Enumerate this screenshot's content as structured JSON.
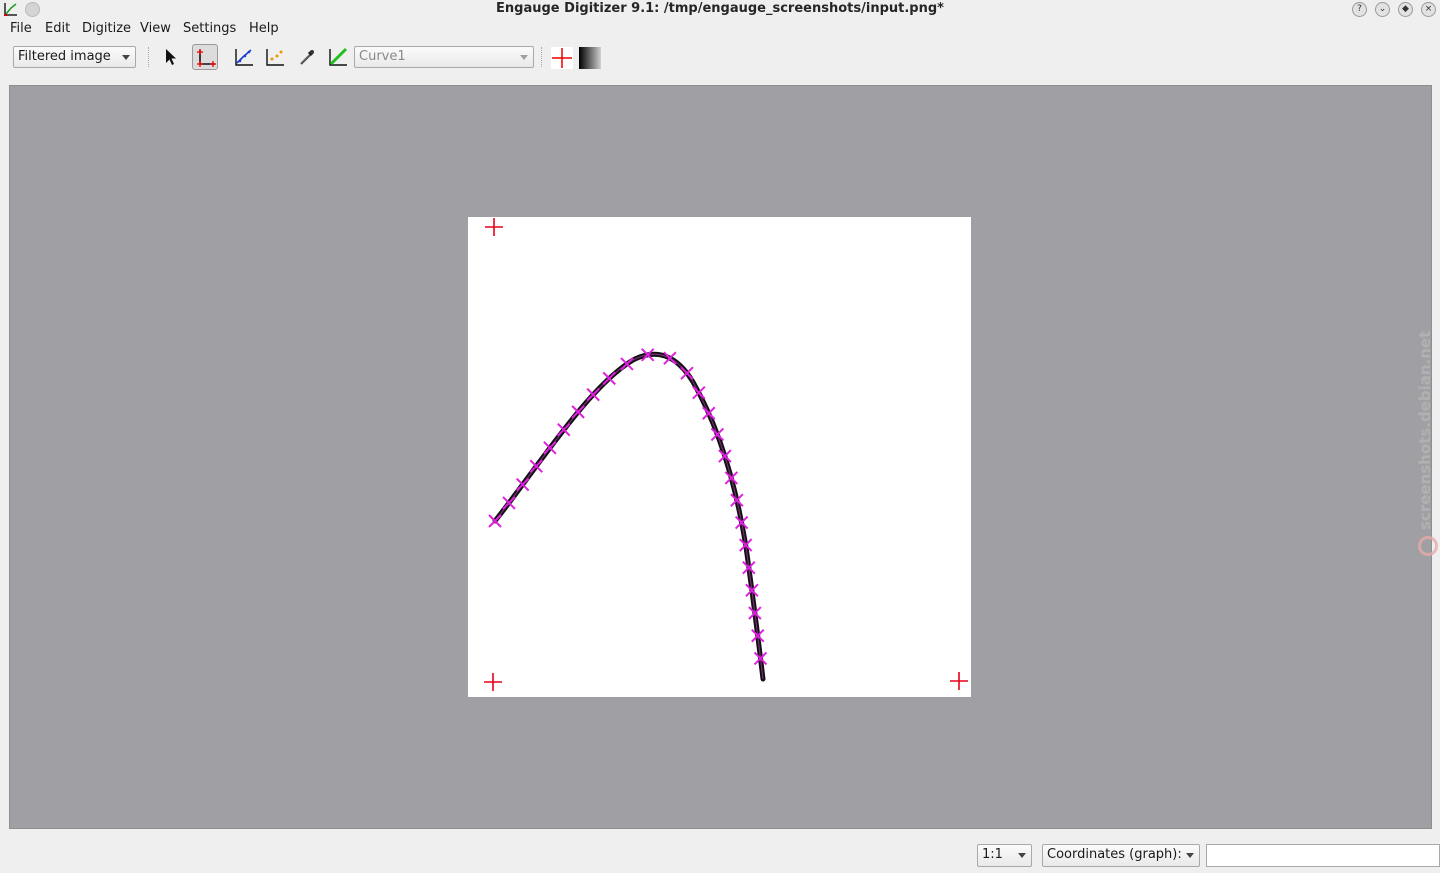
{
  "window": {
    "title": "Engauge Digitizer 9.1: /tmp/engauge_screenshots/input.png*"
  },
  "menu": {
    "items": [
      "File",
      "Edit",
      "Digitize",
      "View",
      "Settings",
      "Help"
    ]
  },
  "toolbar": {
    "background_mode": "Filtered image",
    "curve_selector": "Curve1",
    "tools": [
      {
        "name": "select-tool",
        "icon": "arrow-pointer-icon",
        "pressed": false
      },
      {
        "name": "axis-point-tool",
        "icon": "axis-point-icon",
        "pressed": true
      },
      {
        "name": "curve-point-tool",
        "icon": "curve-point-icon",
        "pressed": false
      },
      {
        "name": "point-match-tool",
        "icon": "point-match-icon",
        "pressed": false
      },
      {
        "name": "color-picker-tool",
        "icon": "eyedropper-icon",
        "pressed": false
      },
      {
        "name": "segment-fill-tool",
        "icon": "segment-fill-icon",
        "pressed": false
      },
      {
        "name": "checklist-guide-toggle",
        "icon": "red-cross-icon",
        "pressed": false
      },
      {
        "name": "gradient-toggle",
        "icon": "gradient-icon",
        "pressed": false
      }
    ]
  },
  "document": {
    "axis_points_count": 3,
    "curve_points_count": 26,
    "colors": {
      "axis_marker": "#e8001a",
      "curve_point": "#e020e0",
      "curve_line": "#111111",
      "canvas_background": "#a09fa4"
    }
  },
  "statusbar": {
    "zoom": "1:1",
    "coordinates_mode": "Coordinates (graph):",
    "coordinates_value": ""
  },
  "watermark": {
    "text": "screenshots.debian.net"
  }
}
